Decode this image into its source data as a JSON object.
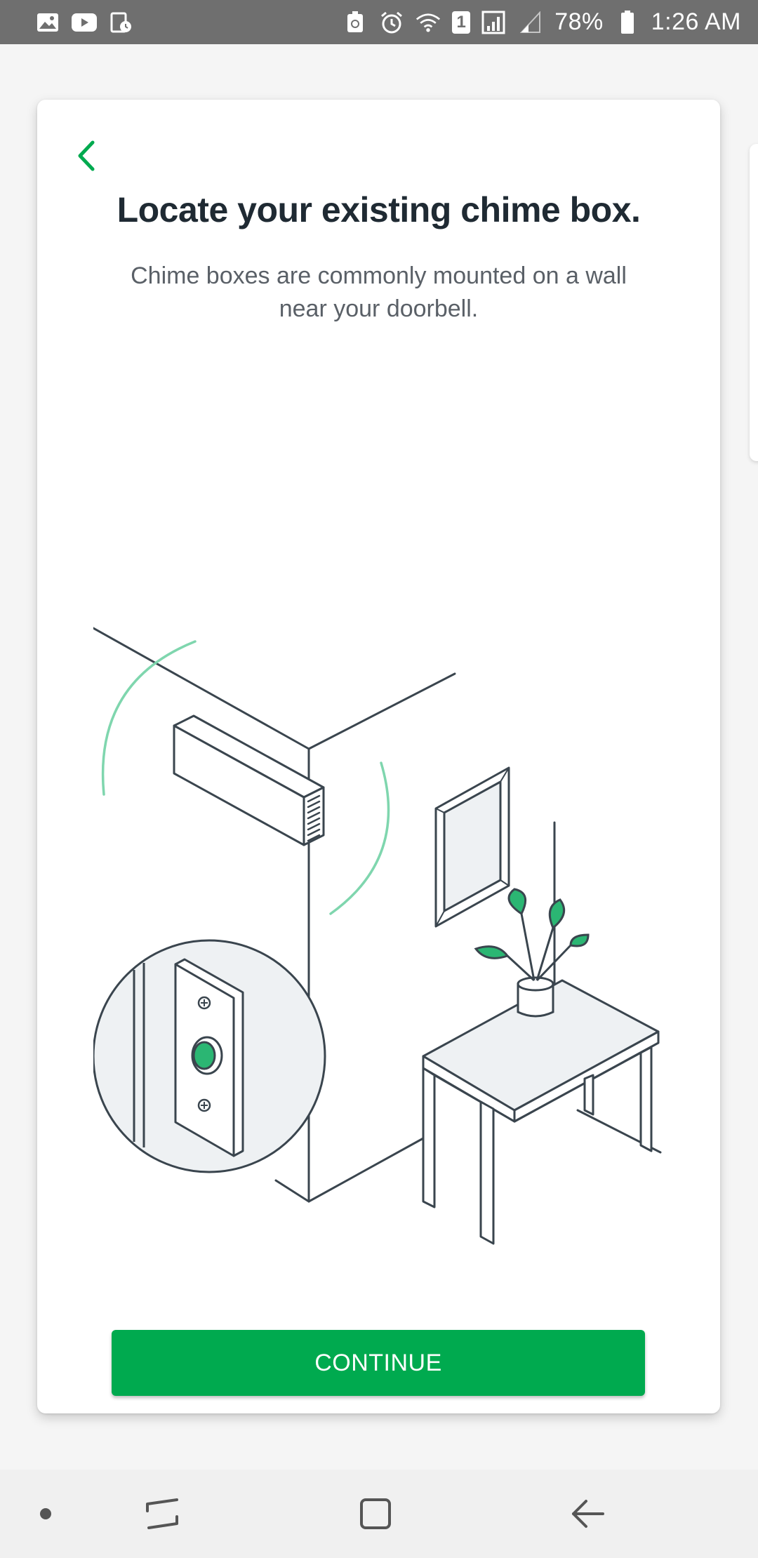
{
  "status_bar": {
    "battery_percent": "78%",
    "time": "1:26 AM",
    "sim_slot": "1",
    "left_icons": [
      "gallery-icon",
      "youtube-icon",
      "clock-app-icon"
    ],
    "right_icons": [
      "lock-sync-icon",
      "alarm-icon",
      "wifi-icon",
      "sim-icon",
      "signal-icon",
      "signal-weak-icon",
      "battery-icon"
    ]
  },
  "card": {
    "title": "Locate your existing chime box.",
    "subtitle": "Chime boxes are commonly mounted on a wall near your doorbell.",
    "continue_label": "CONTINUE"
  },
  "illustration": {
    "subject": "chime-box-wall-doorbell-illustration"
  },
  "colors": {
    "accent": "#00aa4f",
    "title_text": "#1f2a33",
    "subtitle_text": "#5a6067",
    "status_bar_bg": "#6f6f6f",
    "illustration_stroke": "#3a454e",
    "illustration_accent": "#2bb673",
    "illustration_arc": "#7fd6ae"
  }
}
